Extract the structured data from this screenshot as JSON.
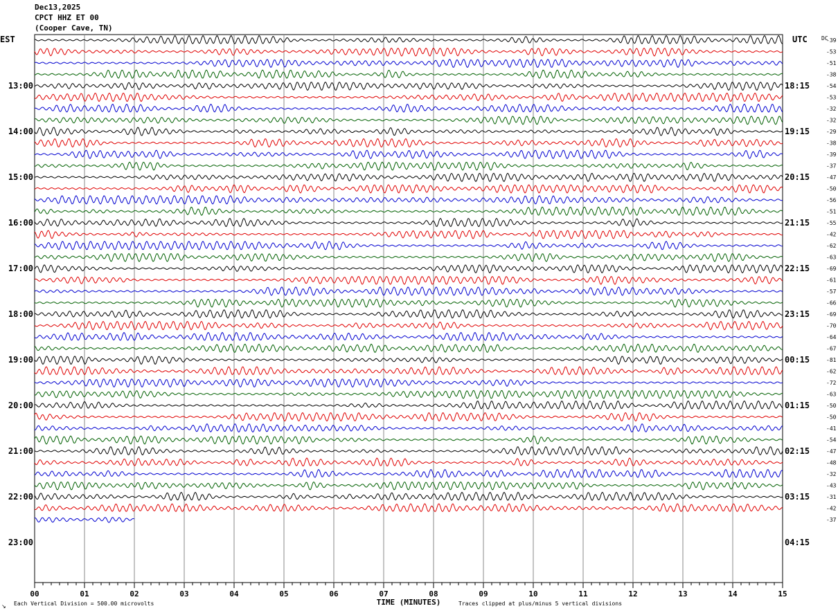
{
  "header": {
    "date": "Dec13,2025",
    "station": "CPCT HHZ ET 00",
    "location": "(Cooper Cave, TN)"
  },
  "left_zone": "EST",
  "right_zone": "UTC",
  "dc_label": "DC",
  "footer": {
    "x_axis_label": "TIME (MINUTES)",
    "scale_note": "Each Vertical Division =  500.00 microvolts",
    "clip_note": "Traces clipped at plus/minus 5 vertical divisions",
    "logo_mark": "↘"
  },
  "chart_data": {
    "type": "line",
    "x_ticks": [
      "00",
      "01",
      "02",
      "03",
      "04",
      "05",
      "06",
      "07",
      "08",
      "09",
      "10",
      "11",
      "12",
      "13",
      "14",
      "15"
    ],
    "x_range": [
      0,
      15
    ],
    "grid_vertical": true,
    "est_hour_labels": [
      "13:00",
      "14:00",
      "15:00",
      "16:00",
      "17:00",
      "18:00",
      "19:00",
      "20:00",
      "21:00",
      "22:00",
      "23:00"
    ],
    "utc_hour_labels": [
      "18:15",
      "19:15",
      "20:15",
      "21:15",
      "22:15",
      "23:15",
      "00:15",
      "01:15",
      "02:15",
      "03:15",
      "04:15"
    ],
    "trace_colors": [
      "#000000",
      "#e00000",
      "#0000d0",
      "#006000"
    ],
    "dc_offsets": [
      -39,
      -53,
      -51,
      -38,
      -54,
      -53,
      -32,
      -32,
      -29,
      -38,
      -39,
      -37,
      -47,
      -50,
      -56,
      -51,
      -55,
      -42,
      -62,
      -63,
      -69,
      -61,
      -57,
      -66,
      -69,
      -70,
      -64,
      -67,
      -81,
      -62,
      -72,
      -63,
      -50,
      -50,
      -41,
      -54,
      -47,
      -48,
      -32,
      -43,
      -31,
      -42,
      -37
    ],
    "trace_count": 43,
    "last_trace_end_minute": 2.0,
    "minutes_per_trace": 15
  }
}
